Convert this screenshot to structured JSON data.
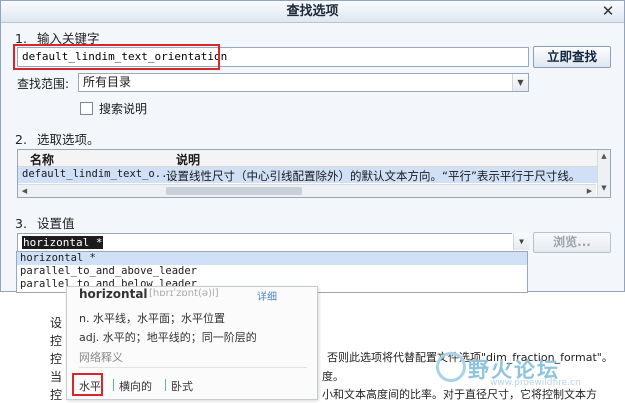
{
  "dialog": {
    "title": "查找选项",
    "close_glyph": "✕"
  },
  "step1": {
    "number": "1.",
    "label": "输入关键字",
    "keyword_value": "default_lindim_text_orientation",
    "search_button": "立即查找"
  },
  "scope": {
    "label": "查找范围:",
    "value": "所有目录"
  },
  "search_desc": {
    "label": "搜索说明",
    "checked": false
  },
  "step2": {
    "number": "2.",
    "label": "选取选项。",
    "columns": [
      "名称",
      "说明"
    ],
    "row": {
      "name": "default_lindim_text_o...",
      "desc": "设置线性尺寸（中心引线配置除外）的默认文本方向。“平行”表示平行于尺寸线。"
    }
  },
  "step3": {
    "number": "3.",
    "label": "设置值",
    "value_selected": "horizontal *",
    "browse_button": "浏览...",
    "options": [
      "horizontal *",
      "parallel_to_and_above_leader",
      "parallel_to_and_below_leader"
    ]
  },
  "background_doc": {
    "lines": [
      "设",
      "控",
      "控",
      "当",
      "控"
    ],
    "right_text_1": "否则此选项将代替配置文件选项\"dim_fraction_format\"。",
    "right_text_2": "度。",
    "right_text_3": "小和文本高度间的比率。对于直径尺寸，它将控制文本方"
  },
  "popup": {
    "word": "horizontal",
    "phonetic": "[hɒrɪˈzɒnt(ə)l]",
    "add": "详细",
    "def1": "n. 水平线，水平面；水平位置",
    "def2": "adj. 水平的；地平线的；同一阶层的",
    "net_label": "网络释义",
    "synonyms": [
      "水平",
      "横向的",
      "卧式"
    ]
  },
  "watermark": {
    "text": "野火论坛",
    "url": "www.proewildfire.cn"
  },
  "colors": {
    "highlight_red": "#d7262c",
    "selection_blue": "#cfe0f7"
  }
}
